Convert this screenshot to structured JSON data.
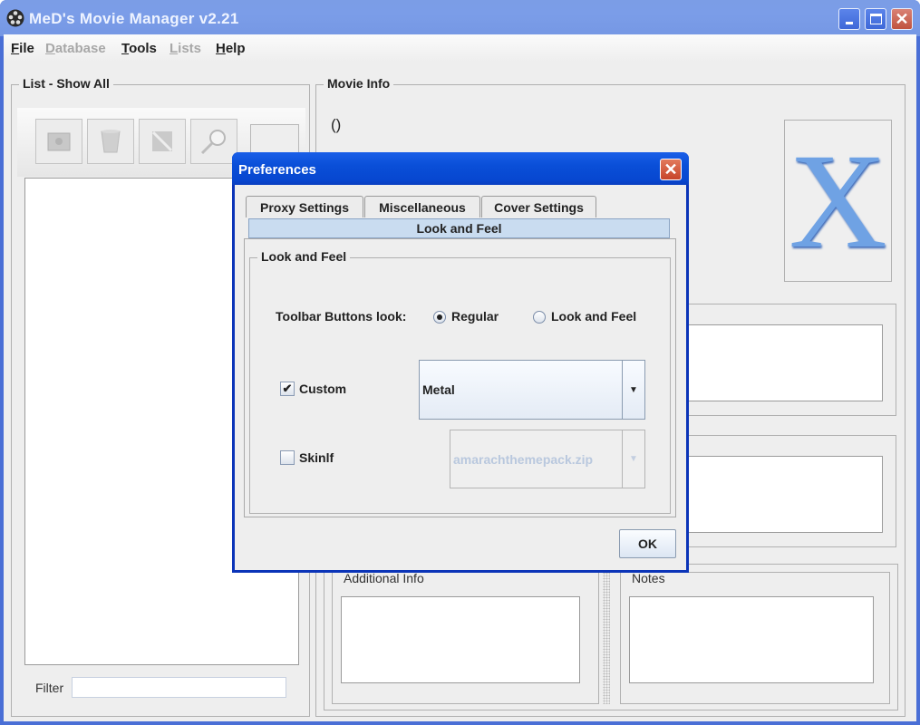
{
  "window": {
    "title": "MeD's Movie Manager v2.21",
    "controls": {
      "minimize": "_",
      "maximize": "□",
      "close": "✕"
    }
  },
  "menubar": {
    "items": [
      {
        "label": "File",
        "mnemonic": "F",
        "rest": "ile",
        "enabled": true
      },
      {
        "label": "Database",
        "mnemonic": "D",
        "rest": "atabase",
        "enabled": false
      },
      {
        "label": "Tools",
        "mnemonic": "T",
        "rest": "ools",
        "enabled": true
      },
      {
        "label": "Lists",
        "mnemonic": "L",
        "rest": "ists",
        "enabled": false
      },
      {
        "label": "Help",
        "mnemonic": "H",
        "rest": "elp",
        "enabled": true
      }
    ]
  },
  "list_panel": {
    "title": "List - Show All",
    "toolbar": [
      "add-movie",
      "remove-movie",
      "edit-movie",
      "search"
    ],
    "filter_label": "Filter",
    "filter_value": ""
  },
  "movie_info": {
    "title": "Movie Info",
    "value": "()",
    "cover_letter": "X",
    "additional_info_label": "Additional Info",
    "notes_label": "Notes"
  },
  "dialog": {
    "title": "Preferences",
    "tabs": [
      {
        "label": "Proxy Settings"
      },
      {
        "label": "Miscellaneous"
      },
      {
        "label": "Cover Settings"
      }
    ],
    "active_tab": "Look and Feel",
    "group_title": "Look and Feel",
    "toolbar_buttons_label": "Toolbar Buttons look:",
    "radio_options": [
      {
        "label": "Regular",
        "selected": true
      },
      {
        "label": "Look and Feel",
        "selected": false
      }
    ],
    "custom": {
      "label": "Custom",
      "checked": true,
      "check_glyph": "✔",
      "value": "Metal"
    },
    "skinlf": {
      "label": "Skinlf",
      "checked": false,
      "value": "amarachthemepack.zip"
    },
    "ok_label": "OK",
    "close_glyph": "✕"
  }
}
